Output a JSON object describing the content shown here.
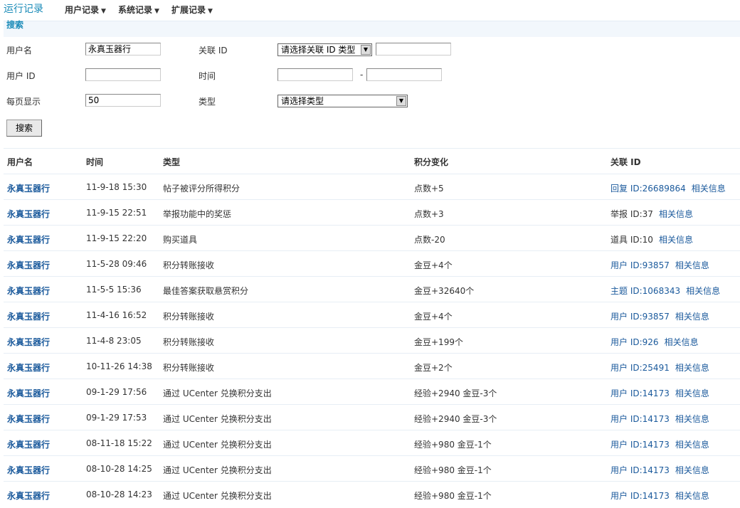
{
  "nav": {
    "brand": "运行记录",
    "menus": [
      "用户记录",
      "系统记录",
      "扩展记录"
    ]
  },
  "search": {
    "header": "搜索",
    "labels": {
      "username": "用户名",
      "related_id": "关联 ID",
      "user_id": "用户 ID",
      "time": "时间",
      "per_page": "每页显示",
      "type": "类型"
    },
    "username_value": "永真玉器行",
    "related_select": "请选择关联 ID 类型",
    "related_input": "",
    "user_id_value": "",
    "time_from": "",
    "time_sep": "-",
    "time_to": "",
    "per_page_value": "50",
    "type_select": "请选择类型",
    "button": "搜索"
  },
  "table": {
    "headers": [
      "用户名",
      "时间",
      "类型",
      "积分变化",
      "关联 ID"
    ],
    "rows": [
      {
        "user": "永真玉器行",
        "time": "11-9-18 15:30",
        "type": "帖子被评分所得积分",
        "change": "点数+5",
        "rel_type": "回复",
        "rel_id": "ID:26689864",
        "rel_link": true,
        "info": "相关信息"
      },
      {
        "user": "永真玉器行",
        "time": "11-9-15 22:51",
        "type": "举报功能中的奖惩",
        "change": "点数+3",
        "rel_type": "举报",
        "rel_id": "ID:37",
        "rel_link": false,
        "info": "相关信息"
      },
      {
        "user": "永真玉器行",
        "time": "11-9-15 22:20",
        "type": "购买道具",
        "change": "点数-20",
        "rel_type": "道具",
        "rel_id": "ID:10",
        "rel_link": false,
        "info": "相关信息"
      },
      {
        "user": "永真玉器行",
        "time": "11-5-28 09:46",
        "type": "积分转账接收",
        "change": "金豆+4个",
        "rel_type": "用户",
        "rel_id": "ID:93857",
        "rel_link": true,
        "info": "相关信息"
      },
      {
        "user": "永真玉器行",
        "time": "11-5-5 15:36",
        "type": "最佳答案获取悬赏积分",
        "change": "金豆+32640个",
        "rel_type": "主题",
        "rel_id": "ID:1068343",
        "rel_link": true,
        "info": "相关信息"
      },
      {
        "user": "永真玉器行",
        "time": "11-4-16 16:52",
        "type": "积分转账接收",
        "change": "金豆+4个",
        "rel_type": "用户",
        "rel_id": "ID:93857",
        "rel_link": true,
        "info": "相关信息"
      },
      {
        "user": "永真玉器行",
        "time": "11-4-8 23:05",
        "type": "积分转账接收",
        "change": "金豆+199个",
        "rel_type": "用户",
        "rel_id": "ID:926",
        "rel_link": true,
        "info": "相关信息"
      },
      {
        "user": "永真玉器行",
        "time": "10-11-26 14:38",
        "type": "积分转账接收",
        "change": "金豆+2个",
        "rel_type": "用户",
        "rel_id": "ID:25491",
        "rel_link": true,
        "info": "相关信息"
      },
      {
        "user": "永真玉器行",
        "time": "09-1-29 17:56",
        "type": "通过 UCenter 兑换积分支出",
        "change": "经验+2940 金豆-3个",
        "rel_type": "用户",
        "rel_id": "ID:14173",
        "rel_link": true,
        "info": "相关信息"
      },
      {
        "user": "永真玉器行",
        "time": "09-1-29 17:53",
        "type": "通过 UCenter 兑换积分支出",
        "change": "经验+2940 金豆-3个",
        "rel_type": "用户",
        "rel_id": "ID:14173",
        "rel_link": true,
        "info": "相关信息"
      },
      {
        "user": "永真玉器行",
        "time": "08-11-18 15:22",
        "type": "通过 UCenter 兑换积分支出",
        "change": "经验+980 金豆-1个",
        "rel_type": "用户",
        "rel_id": "ID:14173",
        "rel_link": true,
        "info": "相关信息"
      },
      {
        "user": "永真玉器行",
        "time": "08-10-28 14:25",
        "type": "通过 UCenter 兑换积分支出",
        "change": "经验+980 金豆-1个",
        "rel_type": "用户",
        "rel_id": "ID:14173",
        "rel_link": true,
        "info": "相关信息"
      },
      {
        "user": "永真玉器行",
        "time": "08-10-28 14:23",
        "type": "通过 UCenter 兑换积分支出",
        "change": "经验+980 金豆-1个",
        "rel_type": "用户",
        "rel_id": "ID:14173",
        "rel_link": true,
        "info": "相关信息"
      }
    ]
  }
}
